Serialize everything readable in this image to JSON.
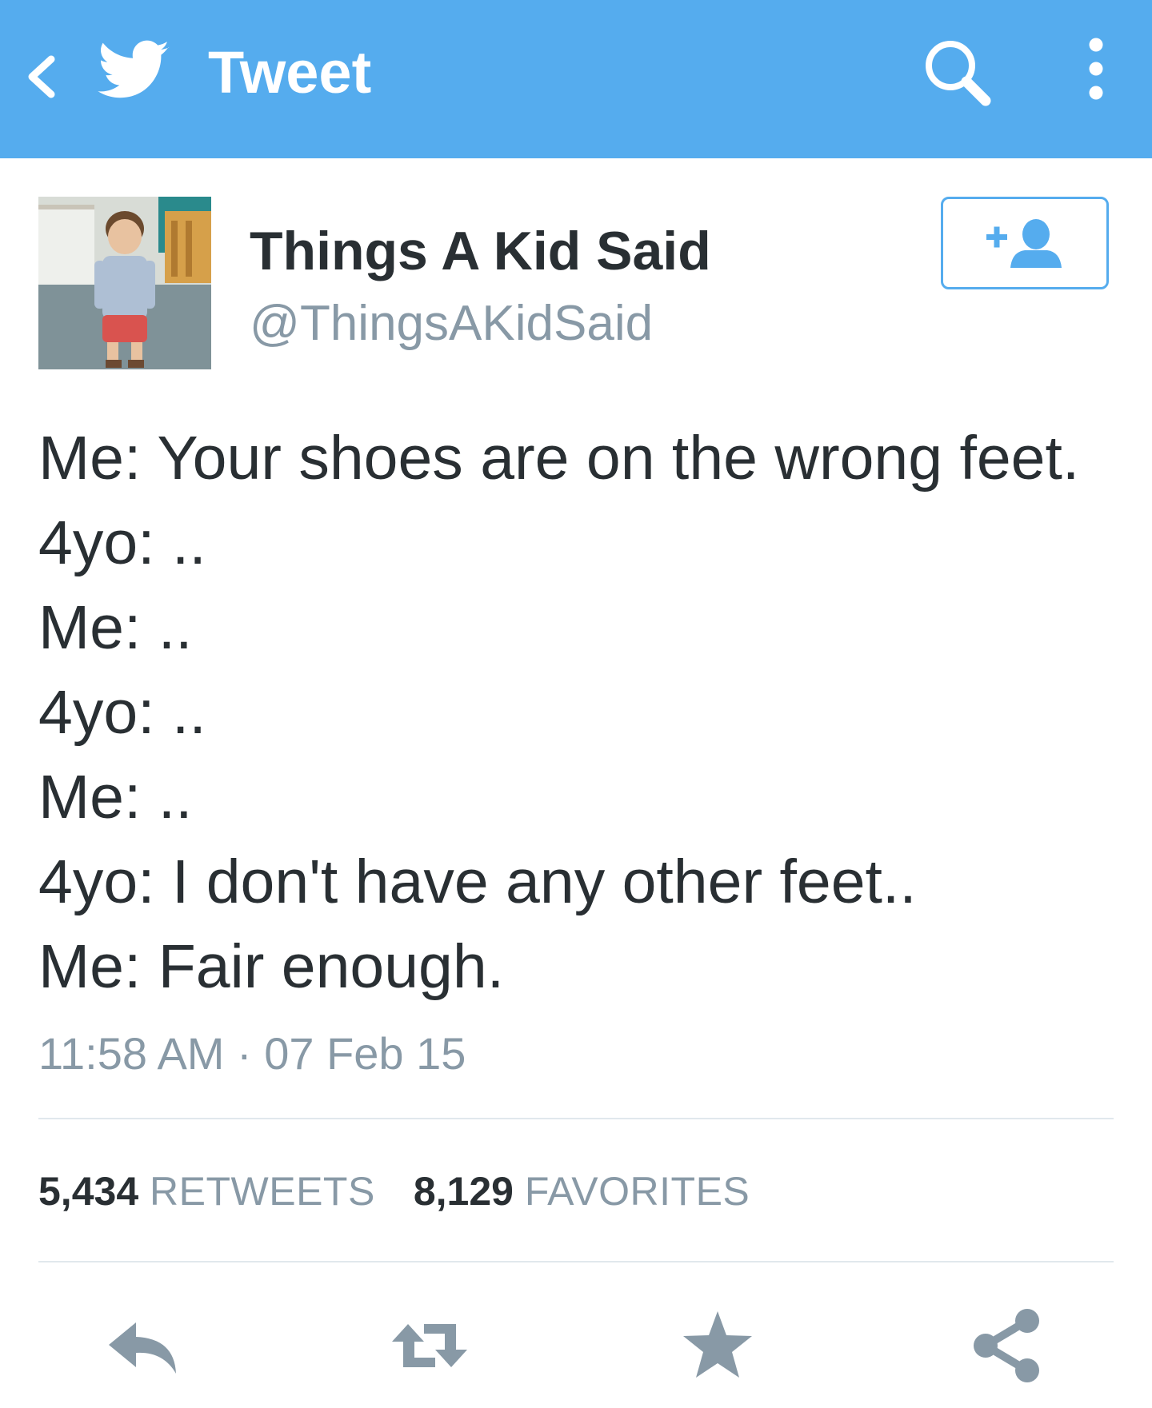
{
  "header": {
    "title": "Tweet",
    "back_icon": "chevron-left-icon",
    "logo_icon": "twitter-bird-icon",
    "search_icon": "search-icon",
    "more_icon": "more-vertical-icon",
    "background_color": "#55acee"
  },
  "author": {
    "name": "Things A Kid Said",
    "handle": "@ThingsAKidSaid",
    "follow_icon": "follow-user-icon"
  },
  "tweet": {
    "lines": [
      "Me: Your shoes are on the wrong feet.",
      "4yo: ..",
      "Me: ..",
      "4yo: ..",
      "Me: ..",
      "4yo: I don't have any other feet..",
      "Me: Fair enough."
    ],
    "timestamp": "11:58 AM · 07 Feb 15"
  },
  "stats": {
    "retweets_count": "5,434",
    "retweets_label": "RETWEETS",
    "favorites_count": "8,129",
    "favorites_label": "FAVORITES"
  },
  "actions": [
    {
      "name": "reply",
      "icon": "reply-icon"
    },
    {
      "name": "retweet",
      "icon": "retweet-icon"
    },
    {
      "name": "favorite",
      "icon": "star-icon"
    },
    {
      "name": "share",
      "icon": "share-icon"
    }
  ],
  "colors": {
    "accent": "#55acee",
    "text": "#292f33",
    "muted": "#8899a6",
    "action_icons": "#8899a6"
  }
}
